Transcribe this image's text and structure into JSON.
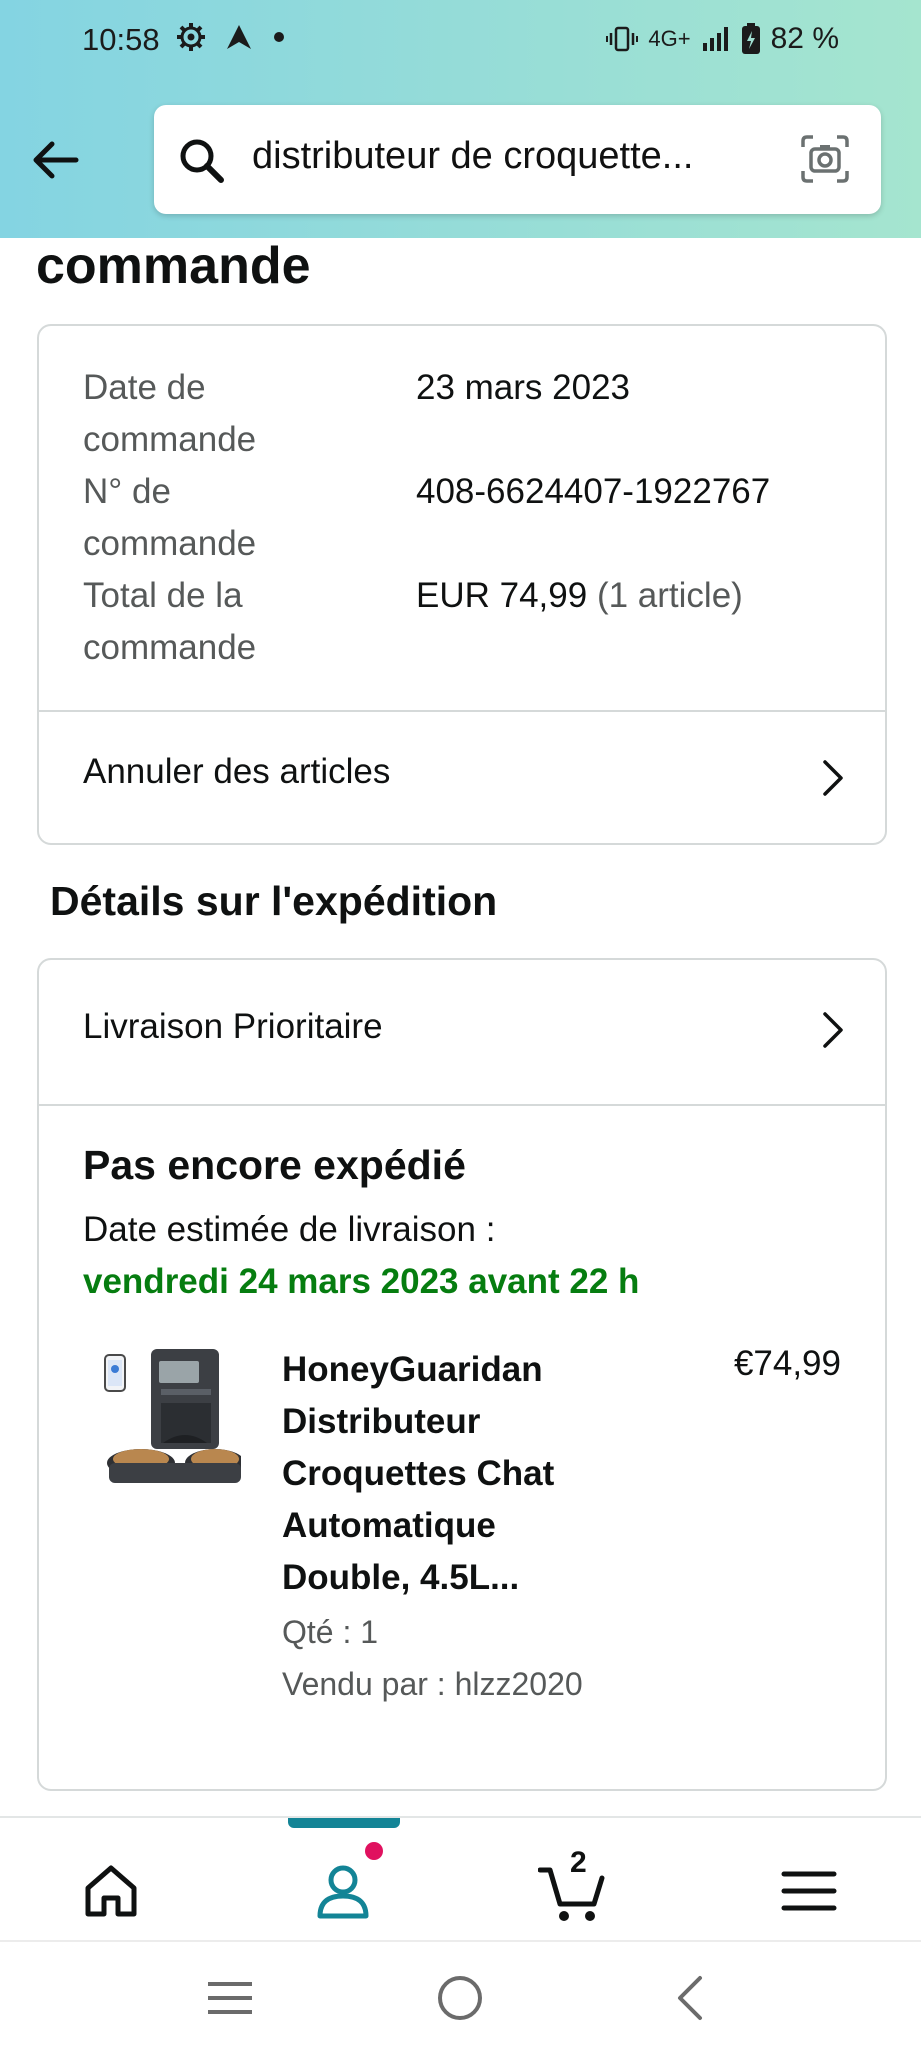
{
  "status_bar": {
    "time": "10:58",
    "network": "4G+",
    "battery": "82 %",
    "icons": [
      "gear-icon",
      "navigation-icon",
      "dot-icon",
      "vibrate-icon",
      "signal-icon",
      "battery-icon"
    ]
  },
  "header": {
    "search_value": "distributeur de croquette...",
    "icons": [
      "back-arrow-icon",
      "search-icon",
      "camera-icon"
    ],
    "colors": {
      "gradient_start": "#84d4e2",
      "gradient_end": "#a5e5cf"
    }
  },
  "page": {
    "title": "commande"
  },
  "order_summary": {
    "date_label_1": "Date de",
    "date_label_2": "commande",
    "date_value": "23 mars 2023",
    "number_label_1": "N° de",
    "number_label_2": "commande",
    "number_value": "408-6624407-1922767",
    "total_label_1": "Total de la",
    "total_label_2": "commande",
    "total_value": "EUR 74,99",
    "total_count": "(1 article)",
    "cancel_label": "Annuler des articles"
  },
  "shipping": {
    "section_title": "Détails sur l'expédition",
    "delivery_method": "Livraison Prioritaire",
    "status": "Pas encore expédié",
    "eta_label": "Date estimée de livraison :",
    "eta_date": "vendredi 24 mars 2023 avant 22 h",
    "eta_color": "#067d10"
  },
  "product": {
    "title_lines": [
      "HoneyGuaridan",
      "Distributeur",
      "Croquettes Chat",
      "Automatique",
      "Double, 4.5L..."
    ],
    "price": "€74,99",
    "qty": "Qté : 1",
    "seller": "Vendu par : hlzz2020"
  },
  "bottom_nav": {
    "items": [
      "home-icon",
      "account-icon",
      "cart-icon",
      "menu-icon"
    ],
    "cart_count": "2",
    "active": "account-icon",
    "accent_color": "#138496",
    "notification_color": "#e0115f"
  },
  "system_nav": {
    "items": [
      "recents-icon",
      "home-circle-icon",
      "back-icon"
    ]
  }
}
